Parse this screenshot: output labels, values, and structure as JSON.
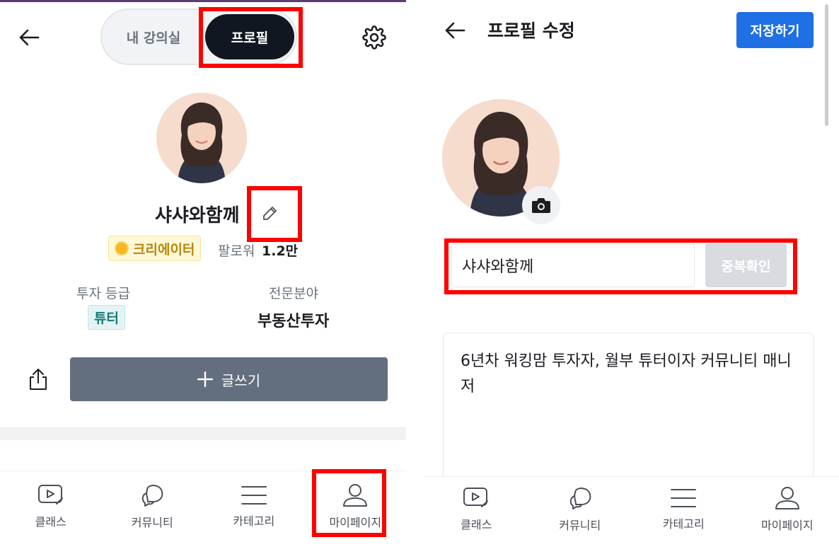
{
  "left": {
    "toggle": {
      "my_class": "내 강의실",
      "profile": "프로필"
    },
    "user": {
      "name": "샤샤와함께",
      "creator_badge": "크리에이터",
      "followers_label": "팔로워",
      "followers_count": "1.2만"
    },
    "stats": {
      "grade_label": "투자 등급",
      "grade_value": "튜터",
      "field_label": "전문분야",
      "field_value": "부동산투자"
    },
    "write_button": "글쓰기",
    "nav": [
      {
        "label": "클래스",
        "icon": "play-video-icon"
      },
      {
        "label": "커뮤니티",
        "icon": "chat-bubble-icon"
      },
      {
        "label": "카테고리",
        "icon": "menu-icon"
      },
      {
        "label": "마이페이지",
        "icon": "user-icon"
      }
    ]
  },
  "right": {
    "title": "프로필 수정",
    "save_button": "저장하기",
    "nickname_value": "샤샤와함께",
    "dup_check_button": "중복확인",
    "bio": "6년차 워킹맘 투자자, 월부 튜터이자 커뮤니티 매니저",
    "nav": [
      {
        "label": "클래스",
        "icon": "play-video-icon"
      },
      {
        "label": "커뮤니티",
        "icon": "chat-bubble-icon"
      },
      {
        "label": "카테고리",
        "icon": "menu-icon"
      },
      {
        "label": "마이페이지",
        "icon": "user-icon"
      }
    ]
  },
  "colors": {
    "highlight": "#ff0000",
    "toggle_active": "#111720",
    "save_button": "#1f6fe5",
    "write_button": "#636e7e",
    "tutor_badge": "#127a78"
  }
}
